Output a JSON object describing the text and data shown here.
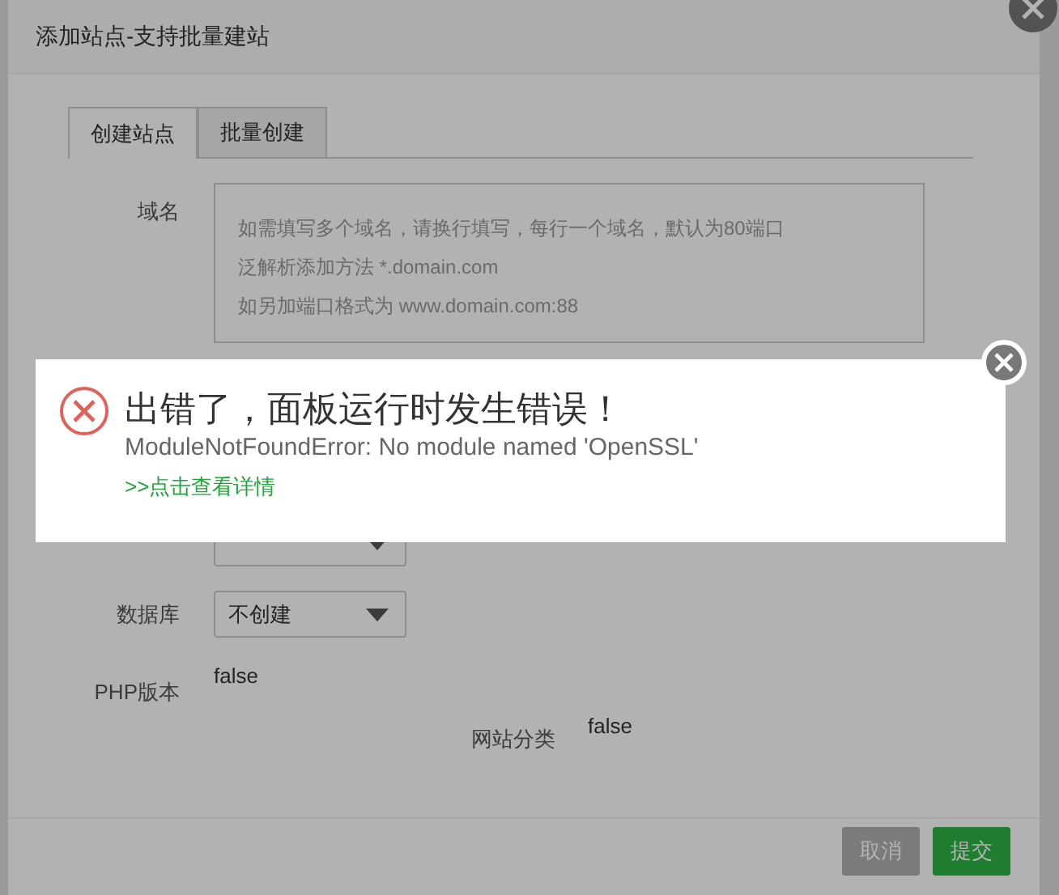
{
  "dialog": {
    "title": "添加站点-支持批量建站",
    "tabs": [
      {
        "label": "创建站点",
        "selected": true
      },
      {
        "label": "批量创建",
        "selected": false
      }
    ],
    "fields": [
      {
        "kind": "textarea",
        "label": "域名",
        "placeholder_lines": [
          "如需填写多个域名，请换行填写，每行一个域名，默认为80端口",
          "泛解析添加方法 *.domain.com",
          "如另加端口格式为 www.domain.com:88"
        ]
      },
      {
        "kind": "covered-select"
      },
      {
        "kind": "select",
        "label": "数据库",
        "value": "不创建"
      },
      {
        "kind": "text",
        "label": "PHP版本",
        "value": "false"
      },
      {
        "kind": "inset-text",
        "label": "网站分类",
        "value": "false"
      }
    ],
    "buttons": [
      {
        "label": "取消",
        "primary": false
      },
      {
        "label": "提交",
        "primary": true
      }
    ]
  },
  "error": {
    "title": "出错了，面板运行时发生错误！",
    "message": "ModuleNotFoundError: No module named 'OpenSSL'",
    "link": ">>点击查看详情"
  }
}
